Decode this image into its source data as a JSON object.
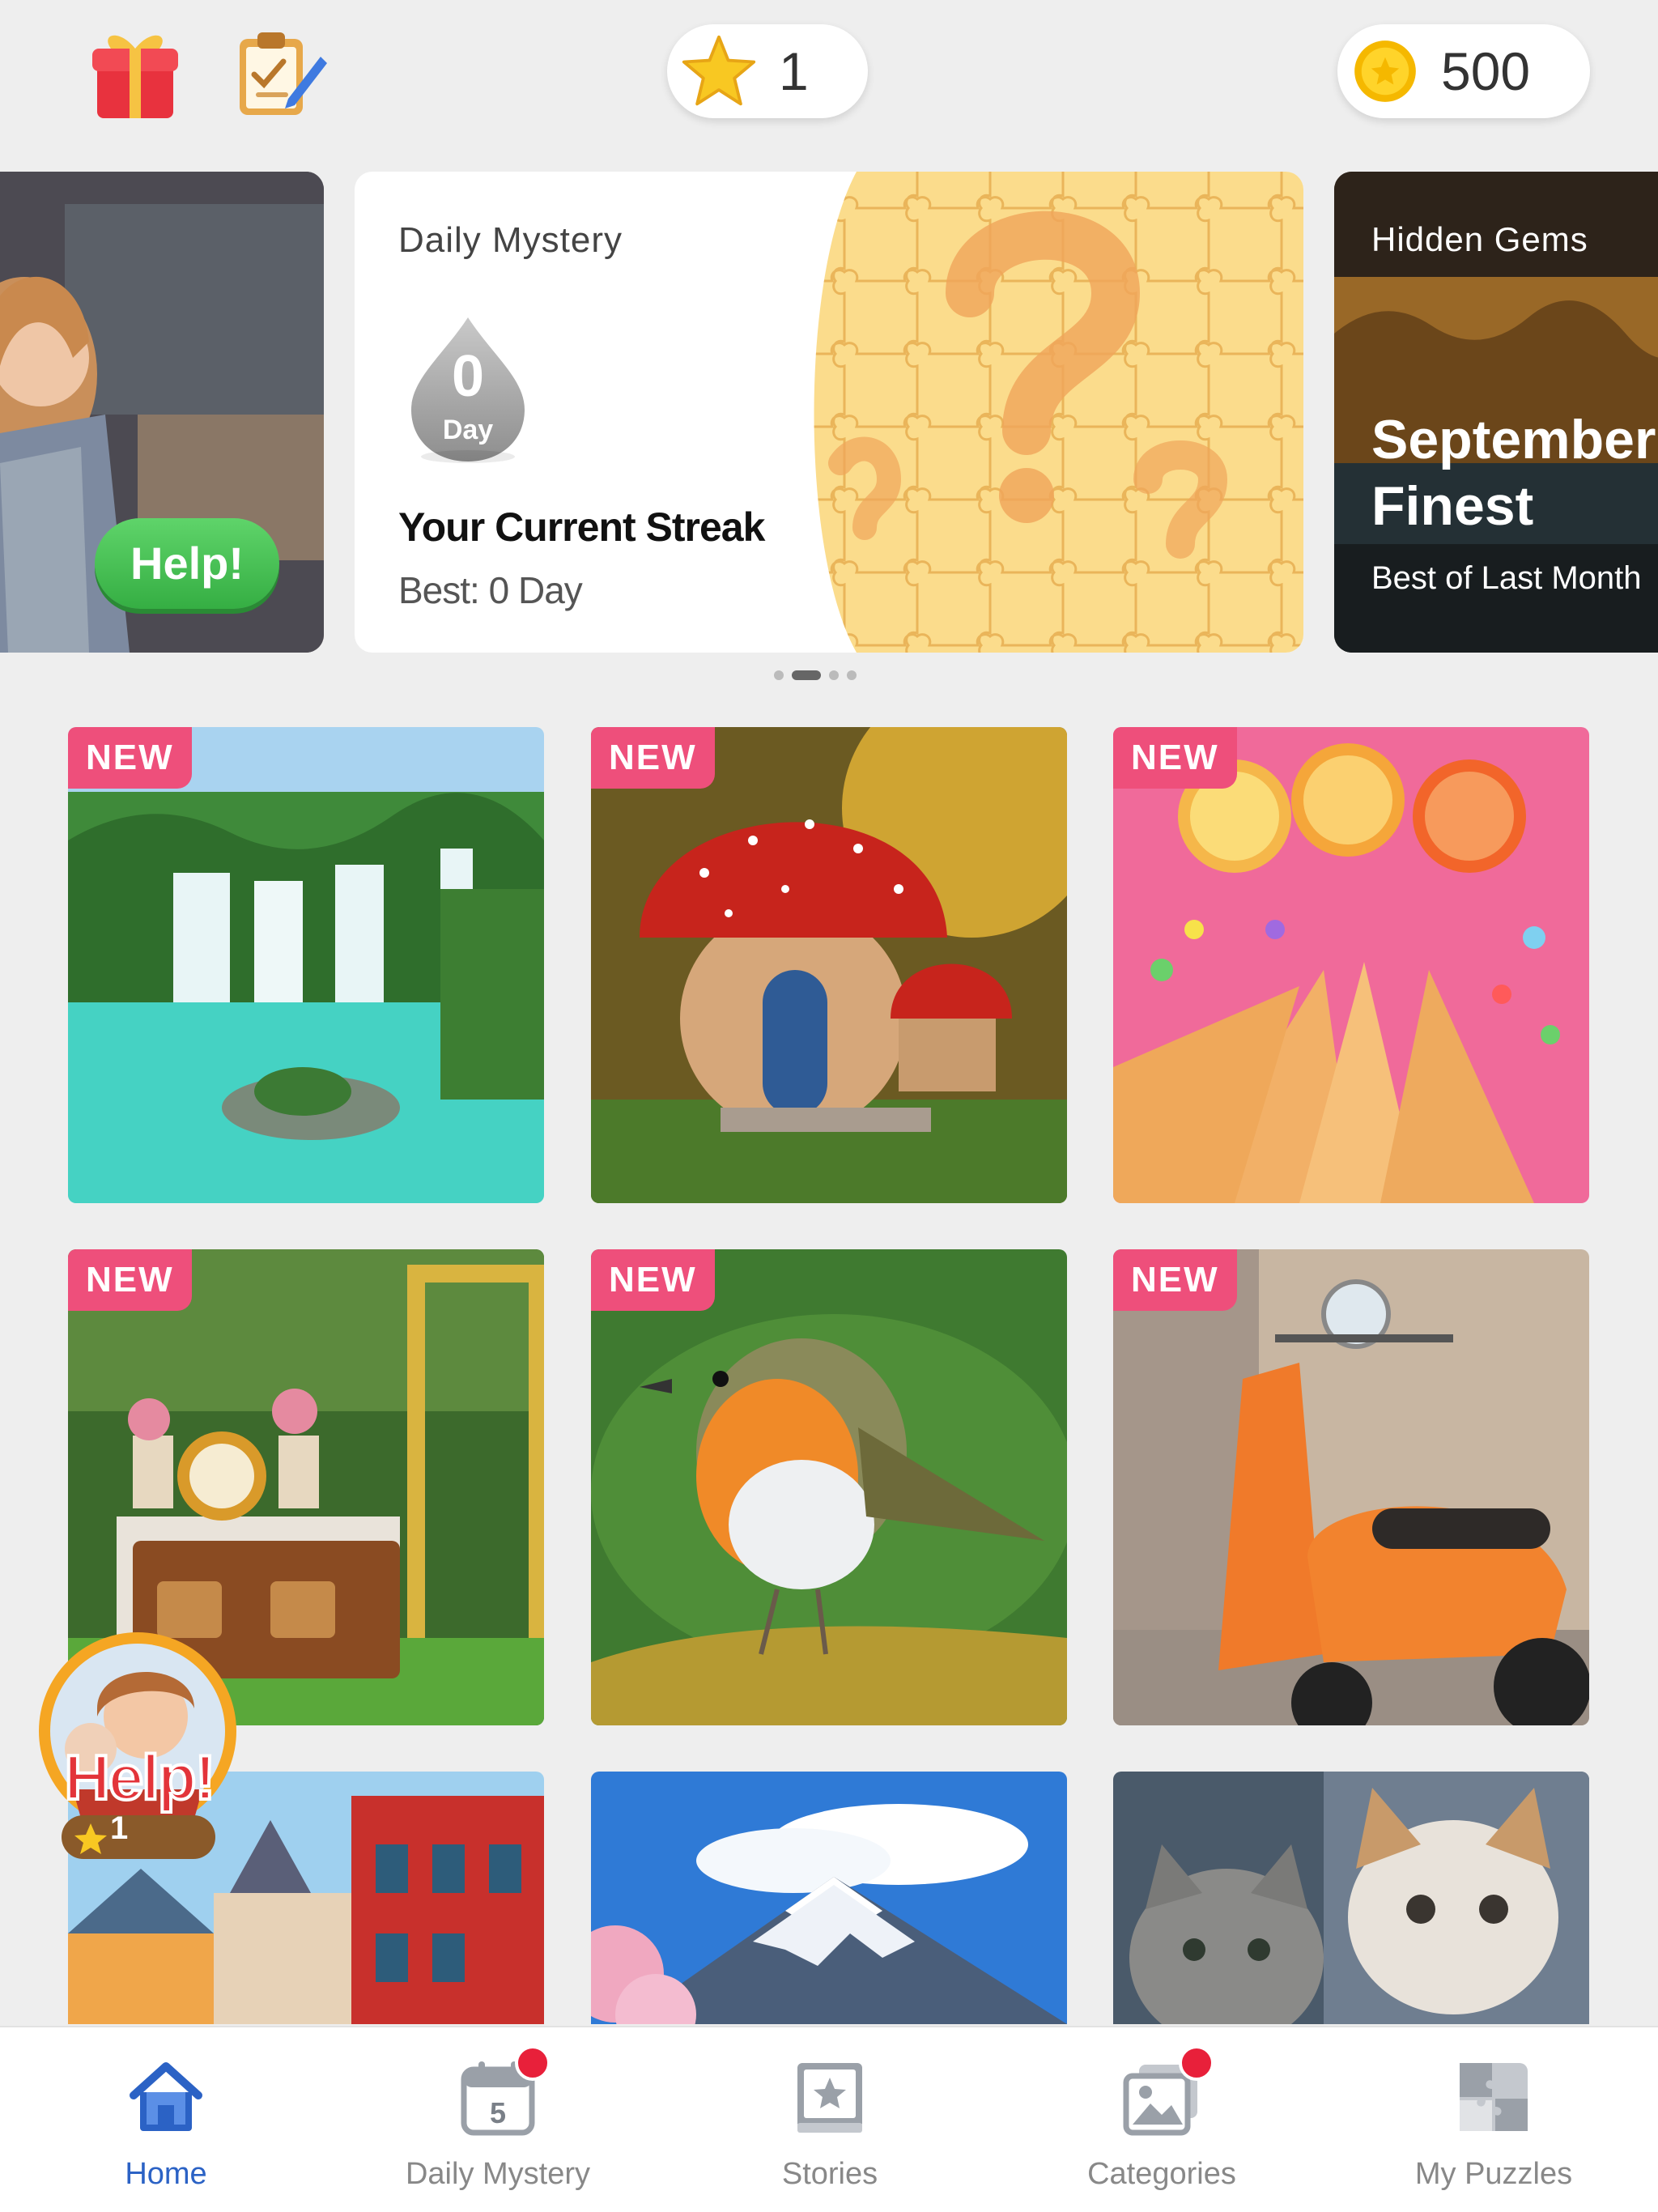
{
  "topbar": {
    "stars": "1",
    "coins": "500",
    "icons": [
      "gift-icon",
      "clipboard-check-icon",
      "star-icon",
      "coin-icon"
    ]
  },
  "carousel": {
    "left_card": {
      "help_label": "Help!"
    },
    "daily_mystery": {
      "title": "Daily Mystery",
      "streak_value": "0",
      "streak_unit": "Day",
      "streak_label": "Your Current Streak",
      "best": "Best: 0 Day"
    },
    "hidden_gems": {
      "title": "Hidden Gems",
      "headline_line1": "September's",
      "headline_line2": "Finest",
      "subtitle": "Best of Last Month"
    },
    "page_count": 4,
    "active_page": 2
  },
  "grid": {
    "new_label": "NEW",
    "tiles": [
      {
        "subject": "waterfall",
        "is_new": true
      },
      {
        "subject": "mushroom-house",
        "is_new": true
      },
      {
        "subject": "candy-lollipops",
        "is_new": true
      },
      {
        "subject": "vintage-clock-radio",
        "is_new": true
      },
      {
        "subject": "robin-bird",
        "is_new": true
      },
      {
        "subject": "orange-scooter",
        "is_new": true
      },
      {
        "subject": "colorful-houses",
        "is_new": false
      },
      {
        "subject": "mount-fuji",
        "is_new": false
      },
      {
        "subject": "kittens",
        "is_new": false
      }
    ]
  },
  "help_float": {
    "label": "Help!",
    "count": "1"
  },
  "bottom_nav": {
    "items": [
      {
        "label": "Home",
        "icon": "home-icon",
        "active": true,
        "badge": false
      },
      {
        "label": "Daily Mystery",
        "icon": "calendar-icon",
        "active": false,
        "badge": true,
        "calendar_day": "5"
      },
      {
        "label": "Stories",
        "icon": "stories-book-icon",
        "active": false,
        "badge": false
      },
      {
        "label": "Categories",
        "icon": "categories-picture-icon",
        "active": false,
        "badge": true
      },
      {
        "label": "My Puzzles",
        "icon": "puzzle-piece-icon",
        "active": false,
        "badge": false
      }
    ]
  },
  "colors": {
    "background": "#eeeeee",
    "new_badge": "#ee4f7b",
    "nav_active": "#2b62c5",
    "nav_inactive": "#888888",
    "help_green": "#35ae43",
    "notification_red": "#e8203a"
  }
}
